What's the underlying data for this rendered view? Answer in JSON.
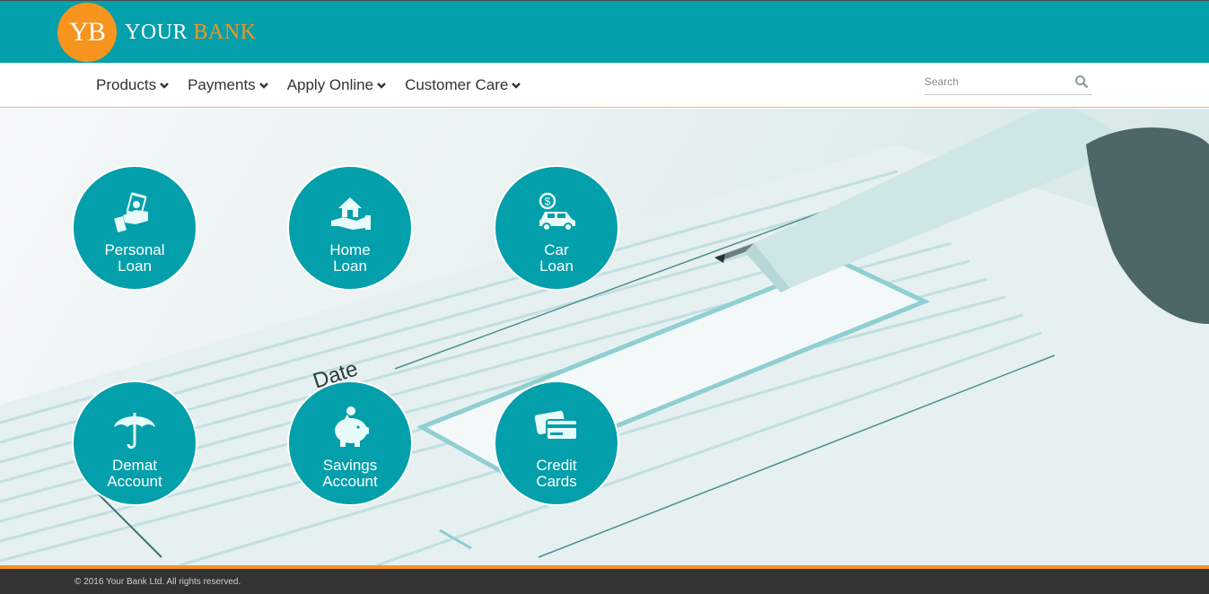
{
  "brand": {
    "initials": "YB",
    "name_part1": "YOUR",
    "name_part2": "BANK",
    "colors": {
      "primary": "#039fab",
      "accent": "#f7941d",
      "footer": "#333333"
    }
  },
  "nav": {
    "items": [
      {
        "label": "Products",
        "icon": "chevron-down-icon"
      },
      {
        "label": "Payments",
        "icon": "chevron-down-icon"
      },
      {
        "label": "Apply Online",
        "icon": "chevron-down-icon"
      },
      {
        "label": "Customer Care",
        "icon": "chevron-down-icon"
      }
    ],
    "search": {
      "placeholder": "Search",
      "value": "",
      "icon": "search-icon"
    }
  },
  "hero": {
    "background_text": "Date",
    "tiles": [
      {
        "line1": "Personal",
        "line2": "Loan",
        "icon": "cash-hand-icon"
      },
      {
        "line1": "Home",
        "line2": "Loan",
        "icon": "house-hand-icon"
      },
      {
        "line1": "Car",
        "line2": "Loan",
        "icon": "car-dollar-icon"
      },
      {
        "line1": "Demat",
        "line2": "Account",
        "icon": "umbrella-icon"
      },
      {
        "line1": "Savings",
        "line2": "Account",
        "icon": "piggy-bank-icon"
      },
      {
        "line1": "Credit",
        "line2": "Cards",
        "icon": "credit-cards-icon"
      }
    ]
  },
  "footer": {
    "copyright": "© 2016 Your Bank Ltd. All rights reserved."
  }
}
